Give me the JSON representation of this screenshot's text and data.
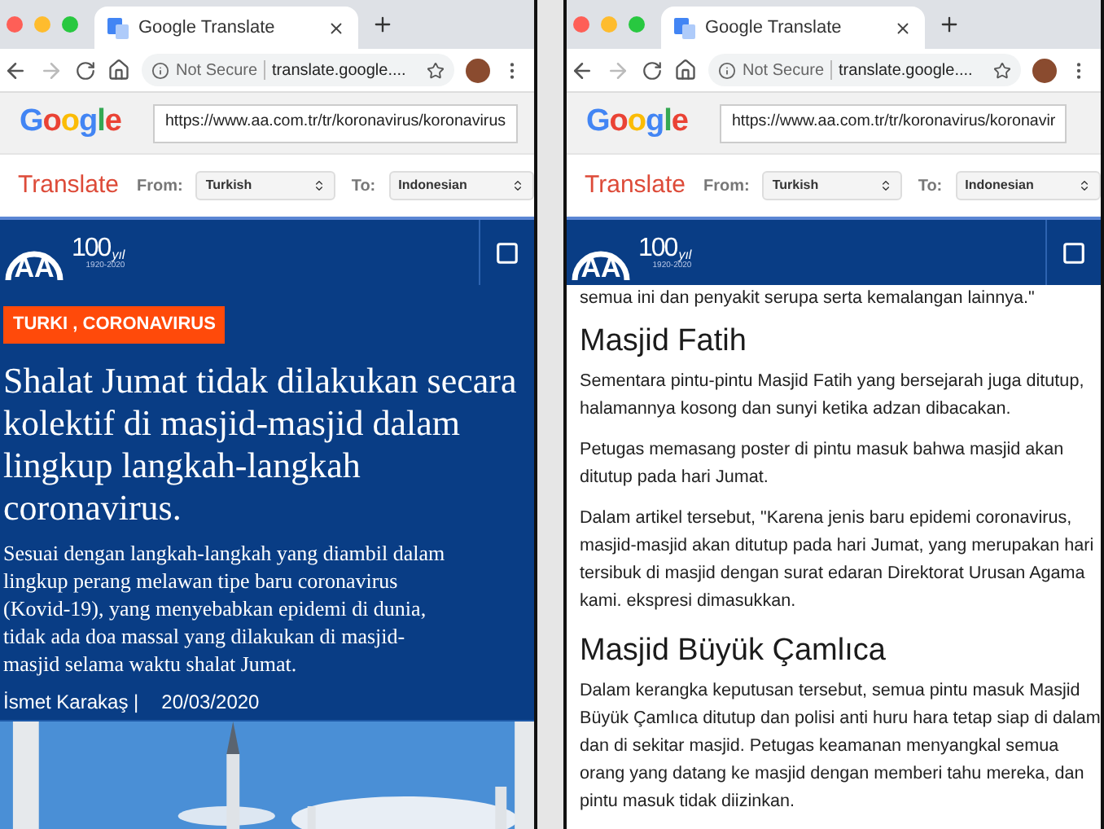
{
  "windows": [
    {
      "tab": {
        "title": "Google Translate"
      },
      "address_bar": {
        "security": "Not Secure",
        "url": "translate.google...."
      },
      "google_logo": "Google",
      "url_field": {
        "value": "https://www.aa.com.tr/tr/koronavirus/koronavirus"
      },
      "translate_bar": {
        "title": "Translate",
        "from_label": "From:",
        "from": "Turkish",
        "to_label": "To:",
        "to": "Indonesian"
      },
      "site_header": {
        "logo": "AA",
        "anniversary": "100",
        "suffix": "yıl",
        "years": "1920-2020"
      },
      "content": {
        "kind": "article_top",
        "tag": "TURKI , CORONAVIRUS",
        "title": "Shalat Jumat tidak dilakukan secara kolektif di masjid-masjid dalam lingkup langkah-langkah coronavirus.",
        "summary": "Sesuai dengan langkah-langkah yang diambil dalam lingkup perang melawan tipe baru coronavirus (Kovid-19), yang menyebabkan epidemi di dunia, tidak ada doa massal yang dilakukan di masjid-masjid selama waktu shalat Jumat.",
        "author": "İsmet Karakaş |",
        "date": "20/03/2020"
      }
    },
    {
      "tab": {
        "title": "Google Translate"
      },
      "address_bar": {
        "security": "Not Secure",
        "url": "translate.google...."
      },
      "google_logo": "Google",
      "url_field": {
        "value": "https://www.aa.com.tr/tr/koronavirus/koronavir"
      },
      "translate_bar": {
        "title": "Translate",
        "from_label": "From:",
        "from": "Turkish",
        "to_label": "To:",
        "to": "Indonesian"
      },
      "site_header": {
        "logo": "AA",
        "anniversary": "100",
        "suffix": "yıl",
        "years": "1920-2020"
      },
      "content": {
        "kind": "article_body",
        "blocks": [
          {
            "kind": "paragraph",
            "text": "semua ini dan penyakit serupa serta kemalangan lainnya.\""
          },
          {
            "kind": "heading",
            "text": "Masjid Fatih"
          },
          {
            "kind": "paragraph",
            "text": "Sementara pintu-pintu Masjid Fatih yang bersejarah juga ditutup, halamannya kosong dan sunyi ketika adzan dibacakan."
          },
          {
            "kind": "paragraph",
            "text": "Petugas memasang poster di pintu masuk bahwa masjid akan ditutup pada hari Jumat."
          },
          {
            "kind": "paragraph",
            "text": "Dalam artikel tersebut, \"Karena jenis baru epidemi coronavirus, masjid-masjid akan ditutup pada hari Jumat, yang merupakan hari tersibuk di masjid dengan surat edaran Direktorat Urusan Agama kami. ekspresi dimasukkan."
          },
          {
            "kind": "heading",
            "text": "Masjid Büyük Çamlıca"
          },
          {
            "kind": "paragraph",
            "text": "Dalam kerangka keputusan tersebut, semua pintu masuk Masjid Büyük Çamlıca ditutup dan polisi anti huru hara tetap siap di dalam dan di sekitar masjid. Petugas keamanan menyangkal semua orang yang datang ke masjid dengan memberi tahu mereka, dan pintu masuk tidak diizinkan."
          }
        ]
      }
    }
  ]
}
